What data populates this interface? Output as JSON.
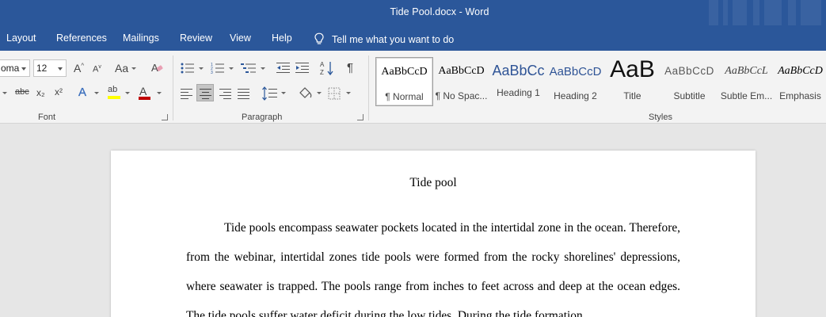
{
  "window": {
    "title": "Tide Pool.docx  -  Word"
  },
  "tabs": [
    {
      "label": "Layout"
    },
    {
      "label": "References"
    },
    {
      "label": "Mailings"
    },
    {
      "label": "Review"
    },
    {
      "label": "View"
    },
    {
      "label": "Help"
    }
  ],
  "tell_me": {
    "label": "Tell me what you want to do"
  },
  "font_group": {
    "label": "Font",
    "font_name": "oma",
    "font_size": "12",
    "case_label": "Aa",
    "strike_label": "abc",
    "subscript_label": "x₂",
    "superscript_label": "x²",
    "text_effects_label": "A",
    "highlight_label": "ab",
    "font_color_label": "A",
    "font_color": "#c00000",
    "highlight_color": "#ffff00"
  },
  "paragraph_group": {
    "label": "Paragraph"
  },
  "styles_group": {
    "label": "Styles",
    "items": [
      {
        "preview": "AaBbCcD",
        "name": "¶ Normal"
      },
      {
        "preview": "AaBbCcD",
        "name": "¶ No Spac..."
      },
      {
        "preview": "AaBbCc",
        "name": "Heading 1"
      },
      {
        "preview": "AaBbCcD",
        "name": "Heading 2"
      },
      {
        "preview": "AaB",
        "name": "Title"
      },
      {
        "preview": "AaBbCcD",
        "name": "Subtitle"
      },
      {
        "preview": "AaBbCcL",
        "name": "Subtle Em..."
      },
      {
        "preview": "AaBbCcD",
        "name": "Emphasis"
      }
    ]
  },
  "document": {
    "title": "Tide pool",
    "paragraph": "Tide pools encompass seawater pockets located in the intertidal zone in the ocean. Therefore, from the webinar, intertidal zones tide pools were formed from the rocky shorelines' depressions, where seawater is trapped. The pools range from inches to feet across and deep at the ocean edges. The tide pools suffer water deficit during the low tides. During the tide formation,"
  },
  "colors": {
    "brand": "#2b579a",
    "heading_blue": "#2f5496"
  }
}
